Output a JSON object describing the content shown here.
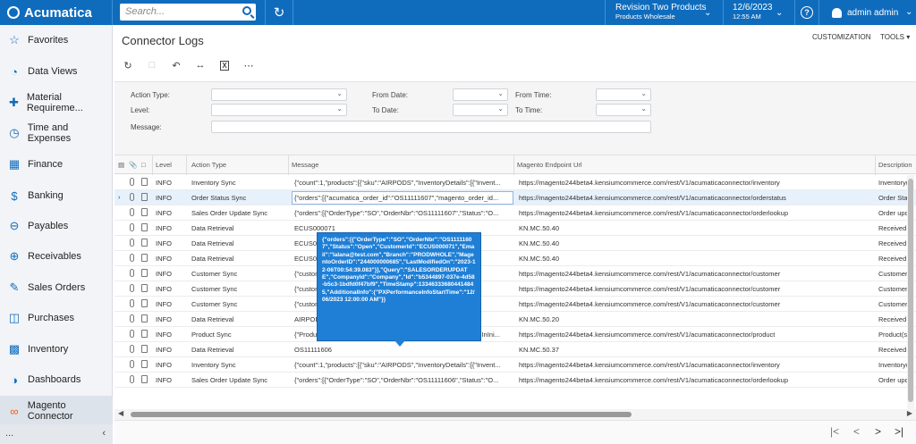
{
  "topbar": {
    "brand": "Acumatica",
    "search_placeholder": "Search...",
    "company_name": "Revision Two Products",
    "company_sub": "Products Wholesale",
    "date": "12/6/2023",
    "time": "12:55 AM",
    "user": "admin admin"
  },
  "sidebar": {
    "items": [
      {
        "label": "Favorites",
        "icon": "star-icon"
      },
      {
        "label": "Data Views",
        "icon": "pie-chart-icon"
      },
      {
        "label": "Material Requireme...",
        "icon": "material-icon"
      },
      {
        "label": "Time and Expenses",
        "icon": "clock-icon"
      },
      {
        "label": "Finance",
        "icon": "calculator-icon"
      },
      {
        "label": "Banking",
        "icon": "dollar-icon"
      },
      {
        "label": "Payables",
        "icon": "minus-circle-icon"
      },
      {
        "label": "Receivables",
        "icon": "plus-circle-icon"
      },
      {
        "label": "Sales Orders",
        "icon": "edit-icon"
      },
      {
        "label": "Purchases",
        "icon": "cart-icon"
      },
      {
        "label": "Inventory",
        "icon": "truck-icon"
      },
      {
        "label": "Dashboards",
        "icon": "dashboard-icon"
      },
      {
        "label": "Magento Connector",
        "icon": "magento-icon"
      }
    ],
    "collapse": "..."
  },
  "page": {
    "title": "Connector Logs",
    "customization": "CUSTOMIZATION",
    "tools": "TOOLS"
  },
  "filters": {
    "action_type": "Action Type:",
    "level": "Level:",
    "message": "Message:",
    "from_date": "From Date:",
    "to_date": "To Date:",
    "from_time": "From Time:",
    "to_time": "To Time:"
  },
  "grid": {
    "columns": [
      "Level",
      "Action Type",
      "Message",
      "Magento Endpoint Url",
      "Description"
    ],
    "rows": [
      {
        "level": "INFO",
        "action": "Inventory Sync",
        "message": "{\"count\":1,\"products\":[{\"sku\":\"AIRPODS\",\"InventoryDetails\":[{\"Invent...",
        "url": "https://magento244beta4.kensiumcommerce.com/rest/V1/acumaticaconnector/inventory",
        "desc": "Inventory(s"
      },
      {
        "level": "INFO",
        "action": "Order Status Sync",
        "message": "{\"orders\":[{\"acumatica_order_id\":\"OS11111607\",\"magento_order_id...",
        "url": "https://magento244beta4.kensiumcommerce.com/rest/V1/acumaticaconnector/orderstatus",
        "desc": "Order Status"
      },
      {
        "level": "INFO",
        "action": "Sales Order Update Sync",
        "message": "{\"orders\":[{\"OrderType\":\"SO\",\"OrderNbr\":\"OS11111607\",\"Status\":\"O...",
        "url": "https://magento244beta4.kensiumcommerce.com/rest/V1/acumaticaconnector/orderlookup",
        "desc": "Order upda"
      },
      {
        "level": "INFO",
        "action": "Data Retrieval",
        "message": "ECUS000071",
        "url": "KN.MC.50.40",
        "desc": "Received th"
      },
      {
        "level": "INFO",
        "action": "Data Retrieval",
        "message": "ECUS000071",
        "url": "KN.MC.50.40",
        "desc": "Received th"
      },
      {
        "level": "INFO",
        "action": "Data Retrieval",
        "message": "ECUS000071",
        "url": "KN.MC.50.40",
        "desc": "Received th"
      },
      {
        "level": "INFO",
        "action": "Customer Sync",
        "message": "{\"customers\":[{\"Customer...",
        "url": "https://magento244beta4.kensiumcommerce.com/rest/V1/acumaticaconnector/customer",
        "desc": "Customer(s"
      },
      {
        "level": "INFO",
        "action": "Customer Sync",
        "message": "{\"customers\":[{\"Customer...",
        "url": "https://magento244beta4.kensiumcommerce.com/rest/V1/acumaticaconnector/customer",
        "desc": "Customer(s"
      },
      {
        "level": "INFO",
        "action": "Customer Sync",
        "message": "{\"customers\":[{\"Customer...",
        "url": "https://magento244beta4.kensiumcommerce.com/rest/V1/acumaticaconnector/customer",
        "desc": "Customer(s"
      },
      {
        "level": "INFO",
        "action": "Data Retrieval",
        "message": "AIRPODS",
        "url": "KN.MC.50.20",
        "desc": "Received th"
      },
      {
        "level": "INFO",
        "action": "Product Sync",
        "message": "{\"Products\":[{\"InventoryID\":\"AIRPODS\",\"Category\":null,\"IncludeInIni...",
        "url": "https://magento244beta4.kensiumcommerce.com/rest/V1/acumaticaconnector/product",
        "desc": "Product(s) c"
      },
      {
        "level": "INFO",
        "action": "Data Retrieval",
        "message": "OS11111606",
        "url": "KN.MC.50.37",
        "desc": "Received th"
      },
      {
        "level": "INFO",
        "action": "Inventory Sync",
        "message": "{\"count\":1,\"products\":[{\"sku\":\"AIRPODS\",\"InventoryDetails\":[{\"Invent...",
        "url": "https://magento244beta4.kensiumcommerce.com/rest/V1/acumaticaconnector/inventory",
        "desc": "Inventory(s"
      },
      {
        "level": "INFO",
        "action": "Sales Order Update Sync",
        "message": "{\"orders\":[{\"OrderType\":\"SO\",\"OrderNbr\":\"OS11111606\",\"Status\":\"O...",
        "url": "https://magento244beta4.kensiumcommerce.com/rest/V1/acumaticaconnector/orderlookup",
        "desc": "Order upda"
      }
    ]
  },
  "tooltip": {
    "text": "{\"orders\":[{\"OrderType\":\"SO\",\"OrderNbr\":\"OS11111607\",\"Status\":\"Open\",\"CustomerId\":\"ECUS000071\",\"Email\":\"lalana@test.com\",\"Branch\":\"PRODWHOLE\",\"MagentoOrderID\":\"244000000685\",\"LastModifiedOn\":\"2023-12-06T00:54:39.083\"}],\"Query\":\"SALESORDERUPDATE\",\"CompanyId\":\"Company\",\"Id\":\"b5344897-037e-4d58-b5c3-1bdfd0f47bf9\",\"TimeStamp\":133463336804414845,\"AdditionalInfo\":{\"PXPerformanceInfoStartTime\":\"12/06/2023 12:00:00 AM\"}}"
  },
  "pager": {
    "first": "|<",
    "prev": "<",
    "next": ">",
    "last": ">|"
  }
}
